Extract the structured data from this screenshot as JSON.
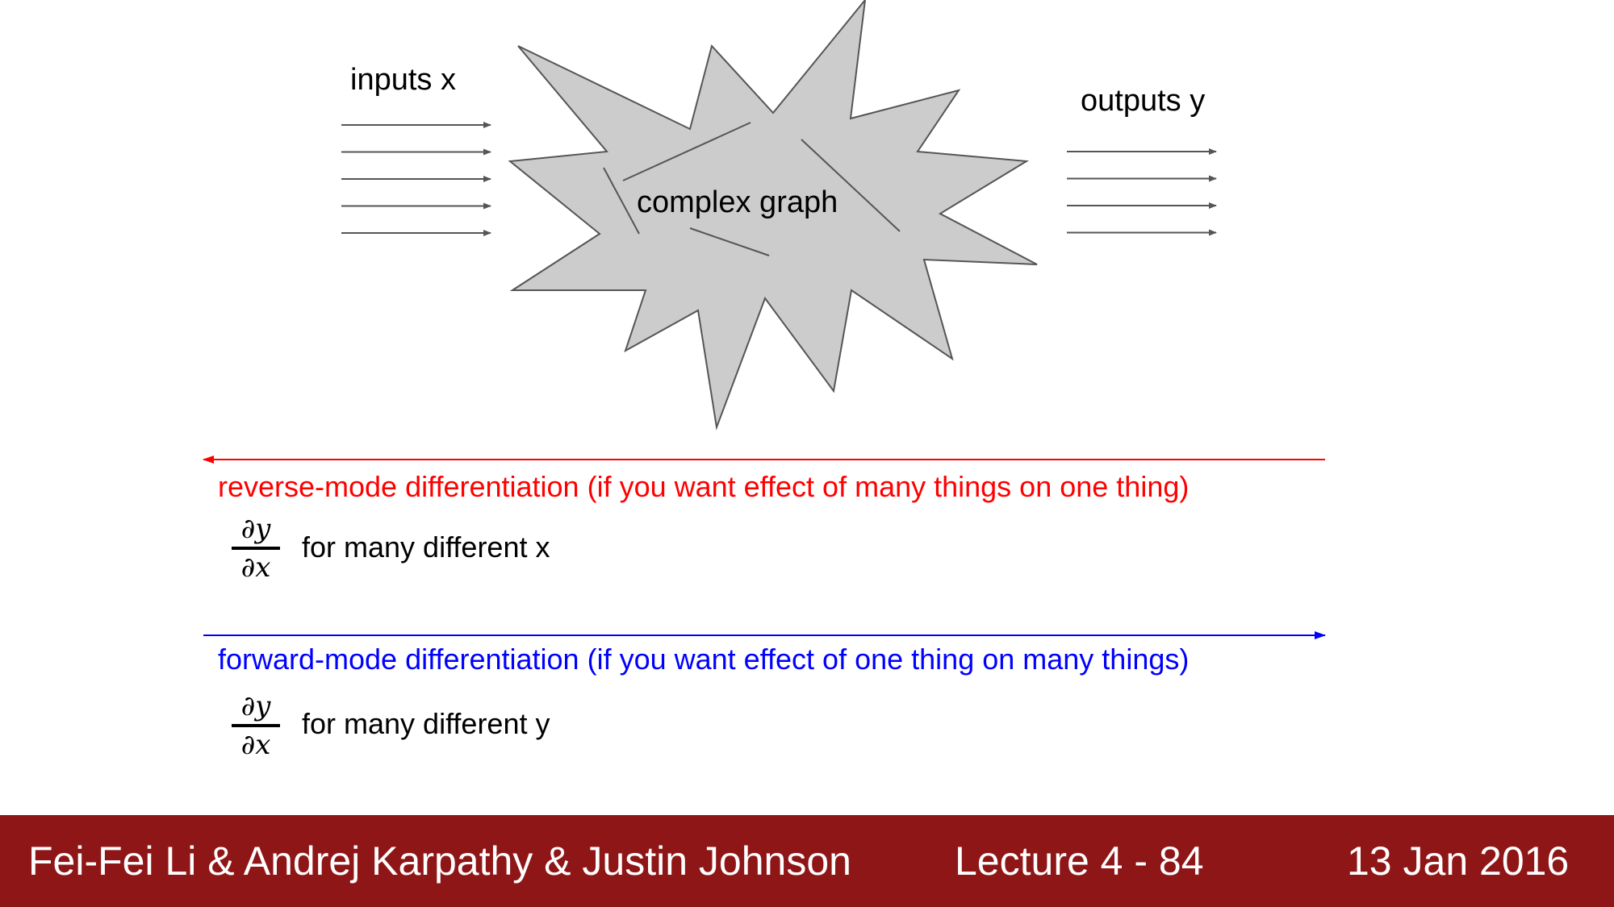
{
  "diagram": {
    "inputs_label": "inputs x",
    "outputs_label": "outputs y",
    "graph_label": "complex graph",
    "input_arrow_count": 5,
    "output_arrow_count": 4
  },
  "reverse_mode": {
    "label": "reverse-mode differentiation (if you want effect of many things on one thing)",
    "color": "#ff0000",
    "formula": {
      "numerator": "∂y",
      "denominator": "∂x"
    },
    "description": "for many different x"
  },
  "forward_mode": {
    "label": "forward-mode differentiation (if you want effect of one thing on many things)",
    "color": "#0000ff",
    "formula": {
      "numerator": "∂y",
      "denominator": "∂x"
    },
    "description": "for many different y"
  },
  "footer": {
    "authors": "Fei-Fei Li & Andrej Karpathy & Justin Johnson",
    "lecture": "Lecture 4 - 84",
    "date": "13 Jan 2016",
    "background_color": "#8f1617"
  }
}
